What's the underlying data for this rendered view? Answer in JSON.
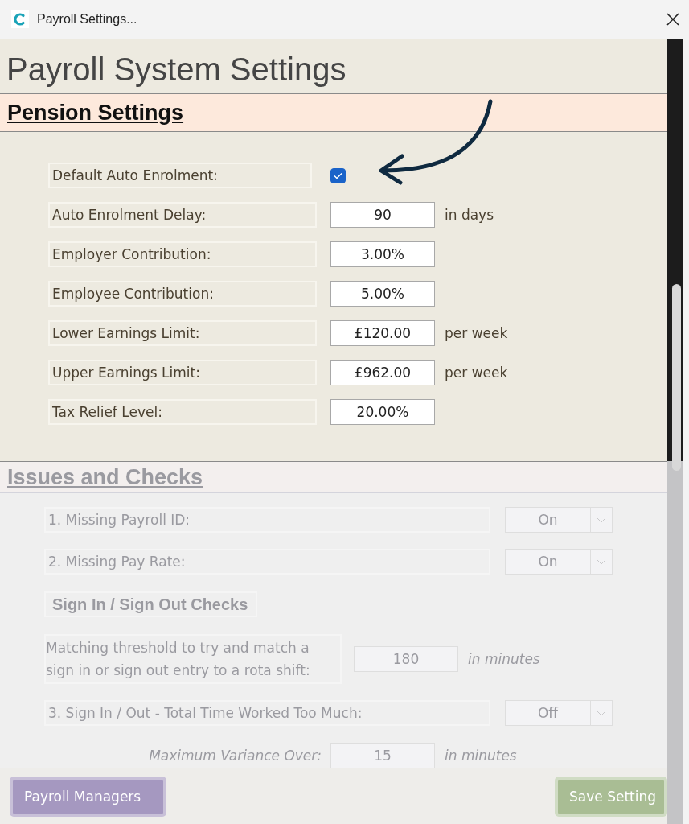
{
  "window": {
    "title": "Payroll Settings..."
  },
  "heading": "Payroll System Settings",
  "pension": {
    "title": "Pension Settings",
    "fields": [
      {
        "kind": "checkbox",
        "label": "Default Auto Enrolment:",
        "checked": true
      },
      {
        "kind": "input",
        "label": "Auto Enrolment Delay:",
        "value": "90",
        "unit": "in days"
      },
      {
        "kind": "input",
        "label": "Employer Contribution:",
        "value": "3.00%"
      },
      {
        "kind": "input",
        "label": "Employee Contribution:",
        "value": "5.00%"
      },
      {
        "kind": "input",
        "label": "Lower Earnings Limit:",
        "value": "£120.00",
        "unit": "per week"
      },
      {
        "kind": "input",
        "label": "Upper Earnings Limit:",
        "value": "£962.00",
        "unit": "per week"
      },
      {
        "kind": "input",
        "label": "Tax Relief Level:",
        "value": "20.00%"
      }
    ]
  },
  "issues": {
    "title": "Issues and Checks",
    "items": [
      {
        "kind": "select",
        "label": "1. Missing Payroll ID:",
        "value": "On"
      },
      {
        "kind": "select",
        "label": "2. Missing Pay Rate:",
        "value": "On"
      },
      {
        "kind": "subheading",
        "label": "Sign In / Sign Out Checks"
      },
      {
        "kind": "threshold",
        "label": "Matching threshold to try and match a sign in or sign out entry to a rota shift:",
        "value": "180",
        "unit": "in minutes"
      },
      {
        "kind": "select",
        "label": "3. Sign In / Out - Total Time Worked Too Much:",
        "value": "Off"
      },
      {
        "kind": "variance",
        "label": "Maximum Variance Over:",
        "value": "15",
        "unit": "in minutes"
      }
    ]
  },
  "buttons": [
    {
      "kind": "managers",
      "label": "Payroll Managers"
    },
    {
      "kind": "save",
      "label": "Save Setting"
    }
  ]
}
